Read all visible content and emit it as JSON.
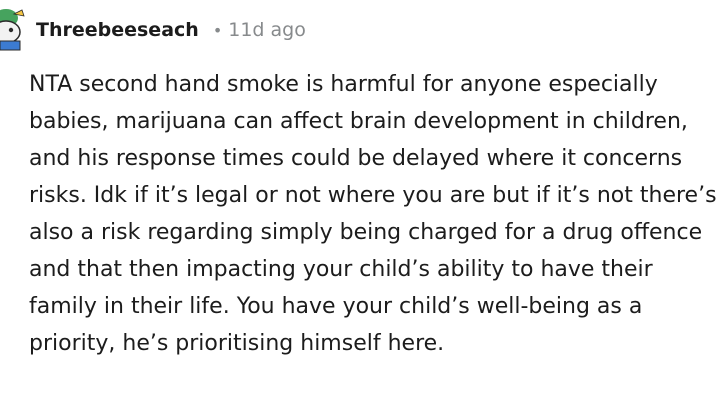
{
  "comment": {
    "author": "Threebeeseach",
    "separator": "•",
    "time_ago": "11d ago",
    "avatar_icon": "snoo-avatar-icon",
    "body": "NTA second hand smoke is harmful for anyone especially babies, marijuana can affect brain development in children, and his response times could be delayed where it concerns risks. Idk if it’s legal or not where you are but if it’s not there’s also a risk regarding simply being charged for a drug offence and that then impacting your child’s ability to have their family in their life. You have your child’s well-being as a priority, he’s prioritising himself here."
  },
  "colors": {
    "text": "#1c1c1c",
    "meta": "#878a8c",
    "avatar_green": "#46a35e",
    "avatar_dark": "#2b2b2b"
  }
}
